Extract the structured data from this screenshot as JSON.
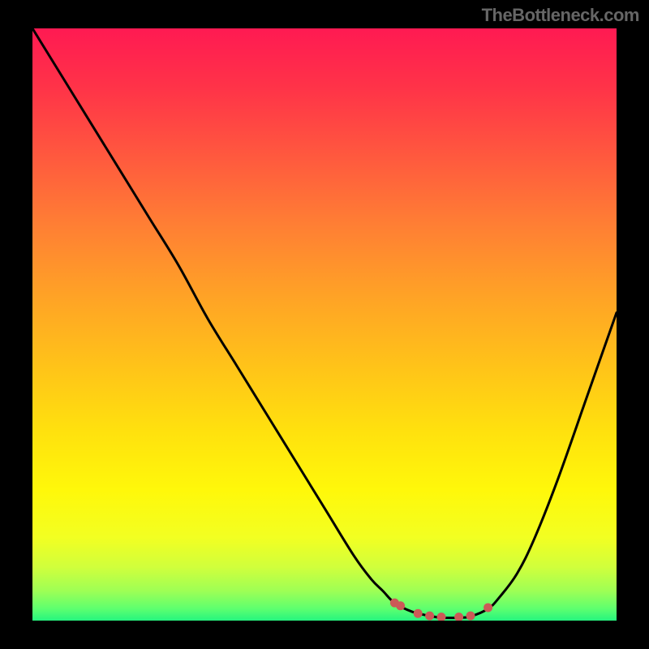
{
  "header": {
    "attribution": "TheBottleneck.com"
  },
  "chart_data": {
    "type": "line",
    "title": "",
    "xlabel": "",
    "ylabel": "",
    "xlim": [
      0,
      100
    ],
    "ylim": [
      0,
      100
    ],
    "x": [
      0,
      5,
      10,
      15,
      20,
      25,
      30,
      35,
      40,
      45,
      50,
      55,
      58,
      60,
      62,
      65,
      68,
      70,
      73,
      75,
      78,
      80,
      83,
      86,
      90,
      95,
      100
    ],
    "y": [
      100,
      92,
      84,
      76,
      68,
      60,
      51,
      43,
      35,
      27,
      19,
      11,
      7,
      5,
      3,
      1.5,
      0.8,
      0.5,
      0.5,
      0.7,
      2,
      4,
      8,
      14,
      24,
      38,
      52
    ],
    "flat_region_x": [
      62,
      78
    ],
    "markers": [
      {
        "x": 62,
        "y": 3
      },
      {
        "x": 63,
        "y": 2.5
      },
      {
        "x": 66,
        "y": 1.2
      },
      {
        "x": 68,
        "y": 0.8
      },
      {
        "x": 70,
        "y": 0.6
      },
      {
        "x": 73,
        "y": 0.6
      },
      {
        "x": 75,
        "y": 0.8
      },
      {
        "x": 78,
        "y": 2.2
      }
    ],
    "colors": {
      "curve": "#000000",
      "marker": "#cc5a57",
      "gradient_top": "#ff1a52",
      "gradient_bottom": "#26f57f"
    }
  }
}
